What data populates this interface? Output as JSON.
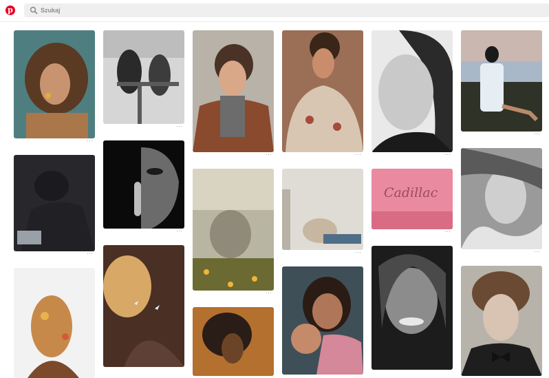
{
  "header": {
    "logo_letter": "p",
    "logo_icon": "pinterest-logo",
    "search_placeholder": "Szukaj",
    "search_icon": "search-icon"
  },
  "colors": {
    "brand": "#e60023",
    "search_bg": "#efefef"
  },
  "pins": {
    "more_label": "···",
    "badge_text": "Cadillac"
  }
}
